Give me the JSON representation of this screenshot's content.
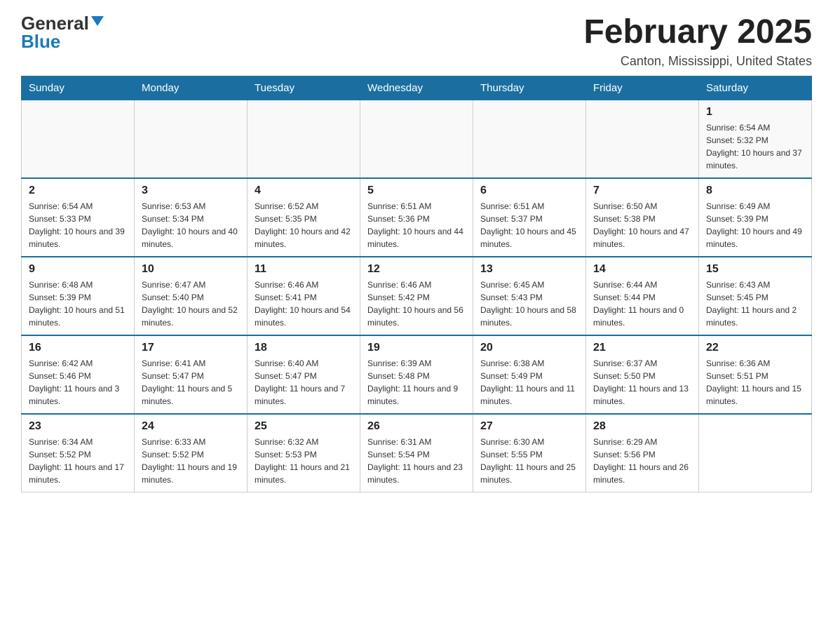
{
  "logo": {
    "general": "General",
    "blue": "Blue"
  },
  "title": "February 2025",
  "subtitle": "Canton, Mississippi, United States",
  "days_of_week": [
    "Sunday",
    "Monday",
    "Tuesday",
    "Wednesday",
    "Thursday",
    "Friday",
    "Saturday"
  ],
  "weeks": [
    [
      {
        "day": "",
        "sunrise": "",
        "sunset": "",
        "daylight": ""
      },
      {
        "day": "",
        "sunrise": "",
        "sunset": "",
        "daylight": ""
      },
      {
        "day": "",
        "sunrise": "",
        "sunset": "",
        "daylight": ""
      },
      {
        "day": "",
        "sunrise": "",
        "sunset": "",
        "daylight": ""
      },
      {
        "day": "",
        "sunrise": "",
        "sunset": "",
        "daylight": ""
      },
      {
        "day": "",
        "sunrise": "",
        "sunset": "",
        "daylight": ""
      },
      {
        "day": "1",
        "sunrise": "Sunrise: 6:54 AM",
        "sunset": "Sunset: 5:32 PM",
        "daylight": "Daylight: 10 hours and 37 minutes."
      }
    ],
    [
      {
        "day": "2",
        "sunrise": "Sunrise: 6:54 AM",
        "sunset": "Sunset: 5:33 PM",
        "daylight": "Daylight: 10 hours and 39 minutes."
      },
      {
        "day": "3",
        "sunrise": "Sunrise: 6:53 AM",
        "sunset": "Sunset: 5:34 PM",
        "daylight": "Daylight: 10 hours and 40 minutes."
      },
      {
        "day": "4",
        "sunrise": "Sunrise: 6:52 AM",
        "sunset": "Sunset: 5:35 PM",
        "daylight": "Daylight: 10 hours and 42 minutes."
      },
      {
        "day": "5",
        "sunrise": "Sunrise: 6:51 AM",
        "sunset": "Sunset: 5:36 PM",
        "daylight": "Daylight: 10 hours and 44 minutes."
      },
      {
        "day": "6",
        "sunrise": "Sunrise: 6:51 AM",
        "sunset": "Sunset: 5:37 PM",
        "daylight": "Daylight: 10 hours and 45 minutes."
      },
      {
        "day": "7",
        "sunrise": "Sunrise: 6:50 AM",
        "sunset": "Sunset: 5:38 PM",
        "daylight": "Daylight: 10 hours and 47 minutes."
      },
      {
        "day": "8",
        "sunrise": "Sunrise: 6:49 AM",
        "sunset": "Sunset: 5:39 PM",
        "daylight": "Daylight: 10 hours and 49 minutes."
      }
    ],
    [
      {
        "day": "9",
        "sunrise": "Sunrise: 6:48 AM",
        "sunset": "Sunset: 5:39 PM",
        "daylight": "Daylight: 10 hours and 51 minutes."
      },
      {
        "day": "10",
        "sunrise": "Sunrise: 6:47 AM",
        "sunset": "Sunset: 5:40 PM",
        "daylight": "Daylight: 10 hours and 52 minutes."
      },
      {
        "day": "11",
        "sunrise": "Sunrise: 6:46 AM",
        "sunset": "Sunset: 5:41 PM",
        "daylight": "Daylight: 10 hours and 54 minutes."
      },
      {
        "day": "12",
        "sunrise": "Sunrise: 6:46 AM",
        "sunset": "Sunset: 5:42 PM",
        "daylight": "Daylight: 10 hours and 56 minutes."
      },
      {
        "day": "13",
        "sunrise": "Sunrise: 6:45 AM",
        "sunset": "Sunset: 5:43 PM",
        "daylight": "Daylight: 10 hours and 58 minutes."
      },
      {
        "day": "14",
        "sunrise": "Sunrise: 6:44 AM",
        "sunset": "Sunset: 5:44 PM",
        "daylight": "Daylight: 11 hours and 0 minutes."
      },
      {
        "day": "15",
        "sunrise": "Sunrise: 6:43 AM",
        "sunset": "Sunset: 5:45 PM",
        "daylight": "Daylight: 11 hours and 2 minutes."
      }
    ],
    [
      {
        "day": "16",
        "sunrise": "Sunrise: 6:42 AM",
        "sunset": "Sunset: 5:46 PM",
        "daylight": "Daylight: 11 hours and 3 minutes."
      },
      {
        "day": "17",
        "sunrise": "Sunrise: 6:41 AM",
        "sunset": "Sunset: 5:47 PM",
        "daylight": "Daylight: 11 hours and 5 minutes."
      },
      {
        "day": "18",
        "sunrise": "Sunrise: 6:40 AM",
        "sunset": "Sunset: 5:47 PM",
        "daylight": "Daylight: 11 hours and 7 minutes."
      },
      {
        "day": "19",
        "sunrise": "Sunrise: 6:39 AM",
        "sunset": "Sunset: 5:48 PM",
        "daylight": "Daylight: 11 hours and 9 minutes."
      },
      {
        "day": "20",
        "sunrise": "Sunrise: 6:38 AM",
        "sunset": "Sunset: 5:49 PM",
        "daylight": "Daylight: 11 hours and 11 minutes."
      },
      {
        "day": "21",
        "sunrise": "Sunrise: 6:37 AM",
        "sunset": "Sunset: 5:50 PM",
        "daylight": "Daylight: 11 hours and 13 minutes."
      },
      {
        "day": "22",
        "sunrise": "Sunrise: 6:36 AM",
        "sunset": "Sunset: 5:51 PM",
        "daylight": "Daylight: 11 hours and 15 minutes."
      }
    ],
    [
      {
        "day": "23",
        "sunrise": "Sunrise: 6:34 AM",
        "sunset": "Sunset: 5:52 PM",
        "daylight": "Daylight: 11 hours and 17 minutes."
      },
      {
        "day": "24",
        "sunrise": "Sunrise: 6:33 AM",
        "sunset": "Sunset: 5:52 PM",
        "daylight": "Daylight: 11 hours and 19 minutes."
      },
      {
        "day": "25",
        "sunrise": "Sunrise: 6:32 AM",
        "sunset": "Sunset: 5:53 PM",
        "daylight": "Daylight: 11 hours and 21 minutes."
      },
      {
        "day": "26",
        "sunrise": "Sunrise: 6:31 AM",
        "sunset": "Sunset: 5:54 PM",
        "daylight": "Daylight: 11 hours and 23 minutes."
      },
      {
        "day": "27",
        "sunrise": "Sunrise: 6:30 AM",
        "sunset": "Sunset: 5:55 PM",
        "daylight": "Daylight: 11 hours and 25 minutes."
      },
      {
        "day": "28",
        "sunrise": "Sunrise: 6:29 AM",
        "sunset": "Sunset: 5:56 PM",
        "daylight": "Daylight: 11 hours and 26 minutes."
      },
      {
        "day": "",
        "sunrise": "",
        "sunset": "",
        "daylight": ""
      }
    ]
  ]
}
